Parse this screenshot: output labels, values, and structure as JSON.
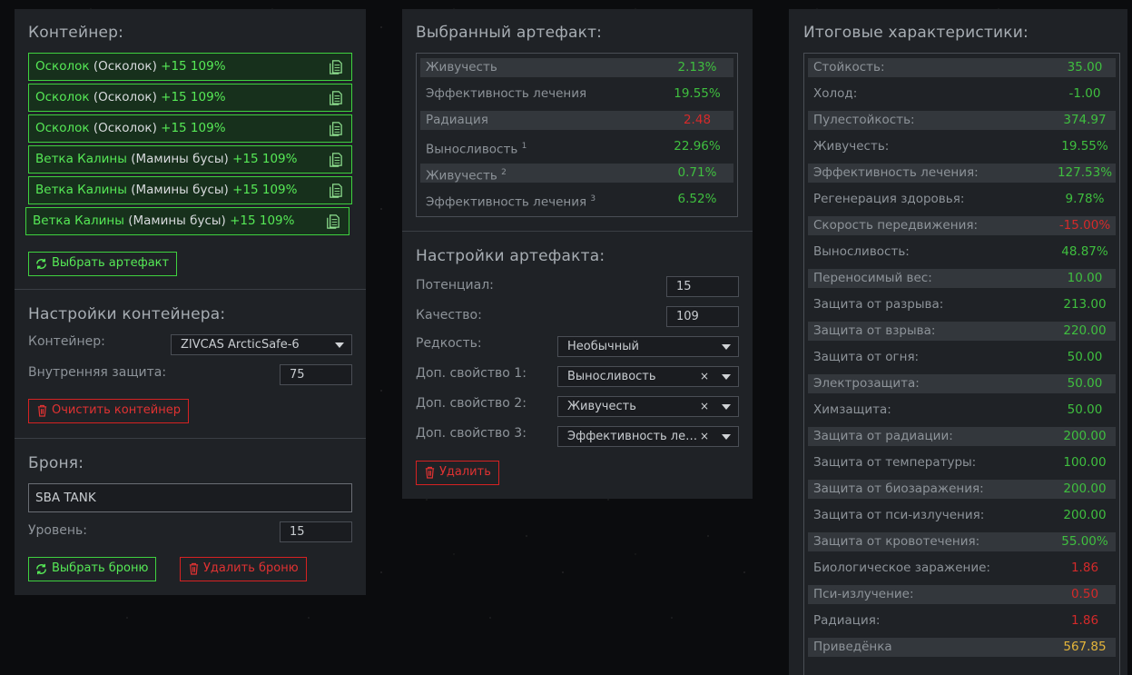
{
  "container_panel": {
    "title": "Контейнер:",
    "items": [
      {
        "name": "Осколок",
        "base": "(Осколок)",
        "stats": "+15 109%"
      },
      {
        "name": "Осколок",
        "base": "(Осколок)",
        "stats": "+15 109%"
      },
      {
        "name": "Осколок",
        "base": "(Осколок)",
        "stats": "+15 109%"
      },
      {
        "name": "Ветка Калины",
        "base": "(Мамины бусы)",
        "stats": "+15 109%"
      },
      {
        "name": "Ветка Калины",
        "base": "(Мамины бусы)",
        "stats": "+15 109%"
      },
      {
        "name": "Ветка Калины",
        "base": "(Мамины бусы)",
        "stats": "+15 109%"
      }
    ],
    "select_artifact_label": "Выбрать артефакт"
  },
  "container_settings": {
    "title": "Настройки контейнера:",
    "container_label": "Контейнер:",
    "container_value": "ZIVCAS ArcticSafe-6",
    "inner_protection_label": "Внутренняя защита:",
    "inner_protection_value": "75",
    "clear_label": "Очистить контейнер"
  },
  "armor": {
    "title": "Броня:",
    "name": "SBA TANK",
    "level_label": "Уровень:",
    "level_value": "15",
    "select_label": "Выбрать броню",
    "delete_label": "Удалить броню"
  },
  "selected_artifact": {
    "title": "Выбранный артефакт:",
    "stats": [
      {
        "label": "Живучесть",
        "sup": "",
        "value": "2.13%",
        "tone": "pos"
      },
      {
        "label": "Эффективность лечения",
        "sup": "",
        "value": "19.55%",
        "tone": "pos"
      },
      {
        "label": "Радиация",
        "sup": "",
        "value": "2.48",
        "tone": "neg"
      },
      {
        "label": "Выносливость",
        "sup": "1",
        "value": "22.96%",
        "tone": "pos"
      },
      {
        "label": "Живучесть",
        "sup": "2",
        "value": "0.71%",
        "tone": "pos"
      },
      {
        "label": "Эффективность лечения",
        "sup": "3",
        "value": "6.52%",
        "tone": "pos"
      }
    ]
  },
  "artifact_settings": {
    "title": "Настройки артефакта:",
    "potential_label": "Потенциал:",
    "potential_value": "15",
    "quality_label": "Качество:",
    "quality_value": "109",
    "rarity_label": "Редкость:",
    "rarity_value": "Необычный",
    "extra1_label": "Доп. свойство 1:",
    "extra1_value": "Выносливость",
    "extra2_label": "Доп. свойство 2:",
    "extra2_value": "Живучесть",
    "extra3_label": "Доп. свойство 3:",
    "extra3_value": "Эффективность лечения",
    "clear_symbol": "×",
    "delete_label": "Удалить"
  },
  "totals": {
    "title": "Итоговые характеристики:",
    "stats": [
      {
        "label": "Стойкость:",
        "value": "35.00",
        "tone": "pos"
      },
      {
        "label": "Холод:",
        "value": "-1.00",
        "tone": "pos"
      },
      {
        "label": "Пулестойкость:",
        "value": "374.97",
        "tone": "pos"
      },
      {
        "label": "Живучесть:",
        "value": "19.55%",
        "tone": "pos"
      },
      {
        "label": "Эффективность лечения:",
        "value": "127.53%",
        "tone": "pos"
      },
      {
        "label": "Регенерация здоровья:",
        "value": "9.78%",
        "tone": "pos"
      },
      {
        "label": "Скорость передвижения:",
        "value": "-15.00%",
        "tone": "neg"
      },
      {
        "label": "Выносливость:",
        "value": "48.87%",
        "tone": "pos"
      },
      {
        "label": "Переносимый вес:",
        "value": "10.00",
        "tone": "pos"
      },
      {
        "label": "Защита от разрыва:",
        "value": "213.00",
        "tone": "pos"
      },
      {
        "label": "Защита от взрыва:",
        "value": "220.00",
        "tone": "pos"
      },
      {
        "label": "Защита от огня:",
        "value": "50.00",
        "tone": "pos"
      },
      {
        "label": "Электрозащита:",
        "value": "50.00",
        "tone": "pos"
      },
      {
        "label": "Химзащита:",
        "value": "50.00",
        "tone": "pos"
      },
      {
        "label": "Защита от радиации:",
        "value": "200.00",
        "tone": "pos"
      },
      {
        "label": "Защита от температуры:",
        "value": "100.00",
        "tone": "pos"
      },
      {
        "label": "Защита от биозаражения:",
        "value": "200.00",
        "tone": "pos"
      },
      {
        "label": "Защита от пси-излучения:",
        "value": "200.00",
        "tone": "pos"
      },
      {
        "label": "Защита от кровотечения:",
        "value": "55.00%",
        "tone": "pos"
      },
      {
        "label": "Биологическое заражение:",
        "value": "1.86",
        "tone": "neg"
      },
      {
        "label": "Пси-излучение:",
        "value": "0.50",
        "tone": "neg"
      },
      {
        "label": "Радиация:",
        "value": "1.86",
        "tone": "neg"
      },
      {
        "label": "Приведёнка",
        "value": "567.85",
        "tone": "gold"
      }
    ]
  },
  "colors": {
    "accent_green": "#3fd13f",
    "danger_red": "#d62222",
    "gold": "#e4b53a",
    "panel_bg": "#1f2226"
  }
}
